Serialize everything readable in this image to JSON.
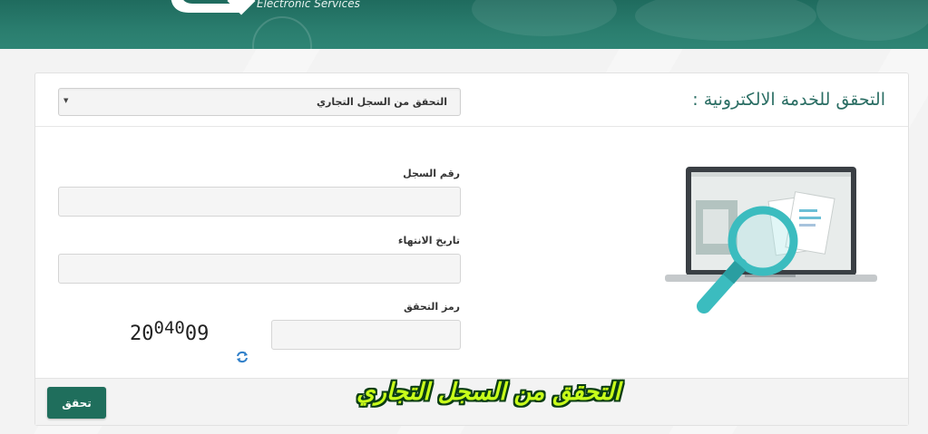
{
  "header": {
    "brand_subtitle": "Electronic Services"
  },
  "form": {
    "title": "التحقق للخدمة الالكترونية :",
    "service_select": {
      "selected": "التحقق من السجل التجاري"
    },
    "fields": [
      {
        "label": "رقم السجل",
        "value": ""
      },
      {
        "label": "تاريخ الانتهاء",
        "value": ""
      },
      {
        "label": "رمز التحقق",
        "value": ""
      }
    ],
    "captcha": {
      "parts": [
        "2",
        "0",
        "0",
        "4",
        "0",
        "0",
        "9"
      ]
    },
    "submit_label": "تحقق"
  },
  "overlay": {
    "caption": "التحقق من السجل التجاري"
  },
  "colors": {
    "header_green": "#2a7d6e",
    "title_teal": "#2b6e64",
    "button_green": "#1f6e5c",
    "caption_lime": "#c8ff1a",
    "magnifier_teal": "#3bbcbf"
  },
  "icons": {
    "refresh": "refresh-icon",
    "dropdown": "chevron-down-icon",
    "illustration": "laptop-magnifier-illustration"
  }
}
